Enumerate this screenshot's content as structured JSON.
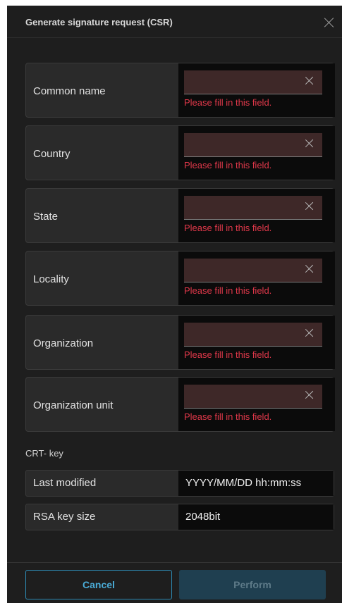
{
  "dialog": {
    "title": "Generate signature request (CSR)"
  },
  "fields": [
    {
      "label": "Common name",
      "value": "",
      "error": "Please fill in this field."
    },
    {
      "label": "Country",
      "value": "",
      "error": "Please fill in this field."
    },
    {
      "label": "State",
      "value": "",
      "error": "Please fill in this field."
    },
    {
      "label": "Locality",
      "value": "",
      "error": "Please fill in this field."
    },
    {
      "label": "Organization",
      "value": "",
      "error": "Please fill in this field."
    },
    {
      "label": "Organization unit",
      "value": "",
      "error": "Please fill in this field."
    }
  ],
  "crt_key": {
    "section_title": "CRT- key",
    "last_modified": {
      "label": "Last modified",
      "value": "YYYY/MM/DD hh:mm:ss"
    },
    "rsa_key_size": {
      "label": "RSA key size",
      "value": "2048bit"
    }
  },
  "footer": {
    "cancel_label": "Cancel",
    "perform_label": "Perform"
  },
  "colors": {
    "background": "#1e1e1e",
    "error": "#e0384a",
    "accent": "#2d8ab3",
    "primary_disabled": "#1f3f50"
  }
}
